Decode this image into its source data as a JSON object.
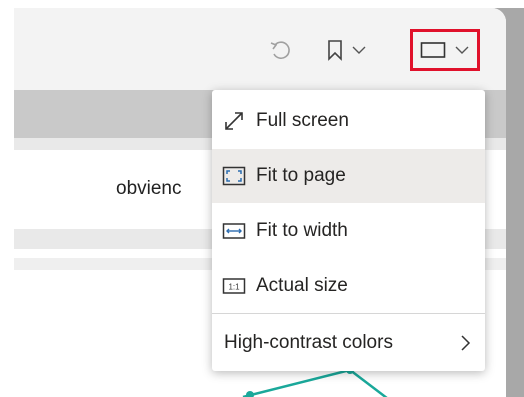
{
  "toolbar": {
    "icons": [
      "undo-icon",
      "bookmark-icon",
      "chevron-down-icon",
      "view-icon"
    ]
  },
  "page": {
    "partial_text": "obvienc"
  },
  "menu": {
    "items": [
      {
        "icon": "full-screen-icon",
        "label": "Full screen",
        "selected": false
      },
      {
        "icon": "fit-to-page-icon",
        "label": "Fit to page",
        "selected": true
      },
      {
        "icon": "fit-to-width-icon",
        "label": "Fit to width",
        "selected": false
      },
      {
        "icon": "actual-size-icon",
        "label": "Actual size",
        "selected": false
      }
    ],
    "high_contrast": {
      "label": "High-contrast colors",
      "icon": "chevron-right-icon"
    },
    "actual_size_glyph": "1:1"
  },
  "colors": {
    "highlight": "#e0112b",
    "selected_bg": "#edebe9",
    "chart_line": "#1aa89a",
    "icon_blue": "#2b6cb0"
  }
}
